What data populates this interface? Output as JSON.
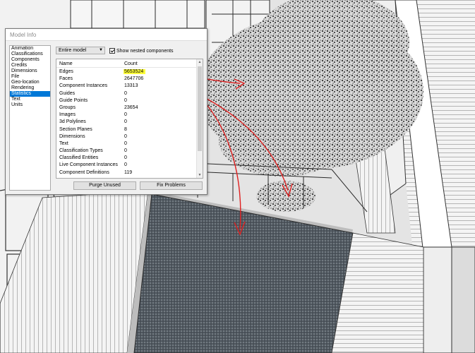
{
  "dialog": {
    "title": "Model Info",
    "sidebar": {
      "items": [
        "Animation",
        "Classifications",
        "Components",
        "Credits",
        "Dimensions",
        "File",
        "Geo-location",
        "Rendering",
        "Statistics",
        "Text",
        "Units"
      ],
      "selected": "Statistics"
    },
    "scope_select": {
      "value": "Entire model"
    },
    "show_nested": {
      "label": "Show nested components",
      "checked": true
    },
    "stats": {
      "headers": {
        "name": "Name",
        "count": "Count"
      },
      "rows": [
        {
          "name": "Edges",
          "count": "5653524",
          "highlight": true
        },
        {
          "name": "Faces",
          "count": "2647706"
        },
        {
          "name": "Component Instances",
          "count": "13313"
        },
        {
          "name": "Guides",
          "count": "0"
        },
        {
          "name": "Guide Points",
          "count": "0"
        },
        {
          "name": "Groups",
          "count": "23654"
        },
        {
          "name": "Images",
          "count": "0"
        },
        {
          "name": "3d Polylines",
          "count": "0"
        },
        {
          "name": "Section Planes",
          "count": "8"
        },
        {
          "name": "Dimensions",
          "count": "0"
        },
        {
          "name": "Text",
          "count": "0"
        },
        {
          "name": "Classification Types",
          "count": "0"
        },
        {
          "name": "Classified Entities",
          "count": "0"
        },
        {
          "name": "Live Component Instances",
          "count": "0"
        },
        {
          "name": "Component Definitions",
          "count": "119"
        }
      ]
    },
    "buttons": {
      "purge": "Purge Unused",
      "fix": "Fix Problems"
    }
  },
  "colors": {
    "highlight": "#ffff3a",
    "selection": "#0078d7",
    "annotation_arrow": "#e02020",
    "mesh": "#4a5258"
  }
}
